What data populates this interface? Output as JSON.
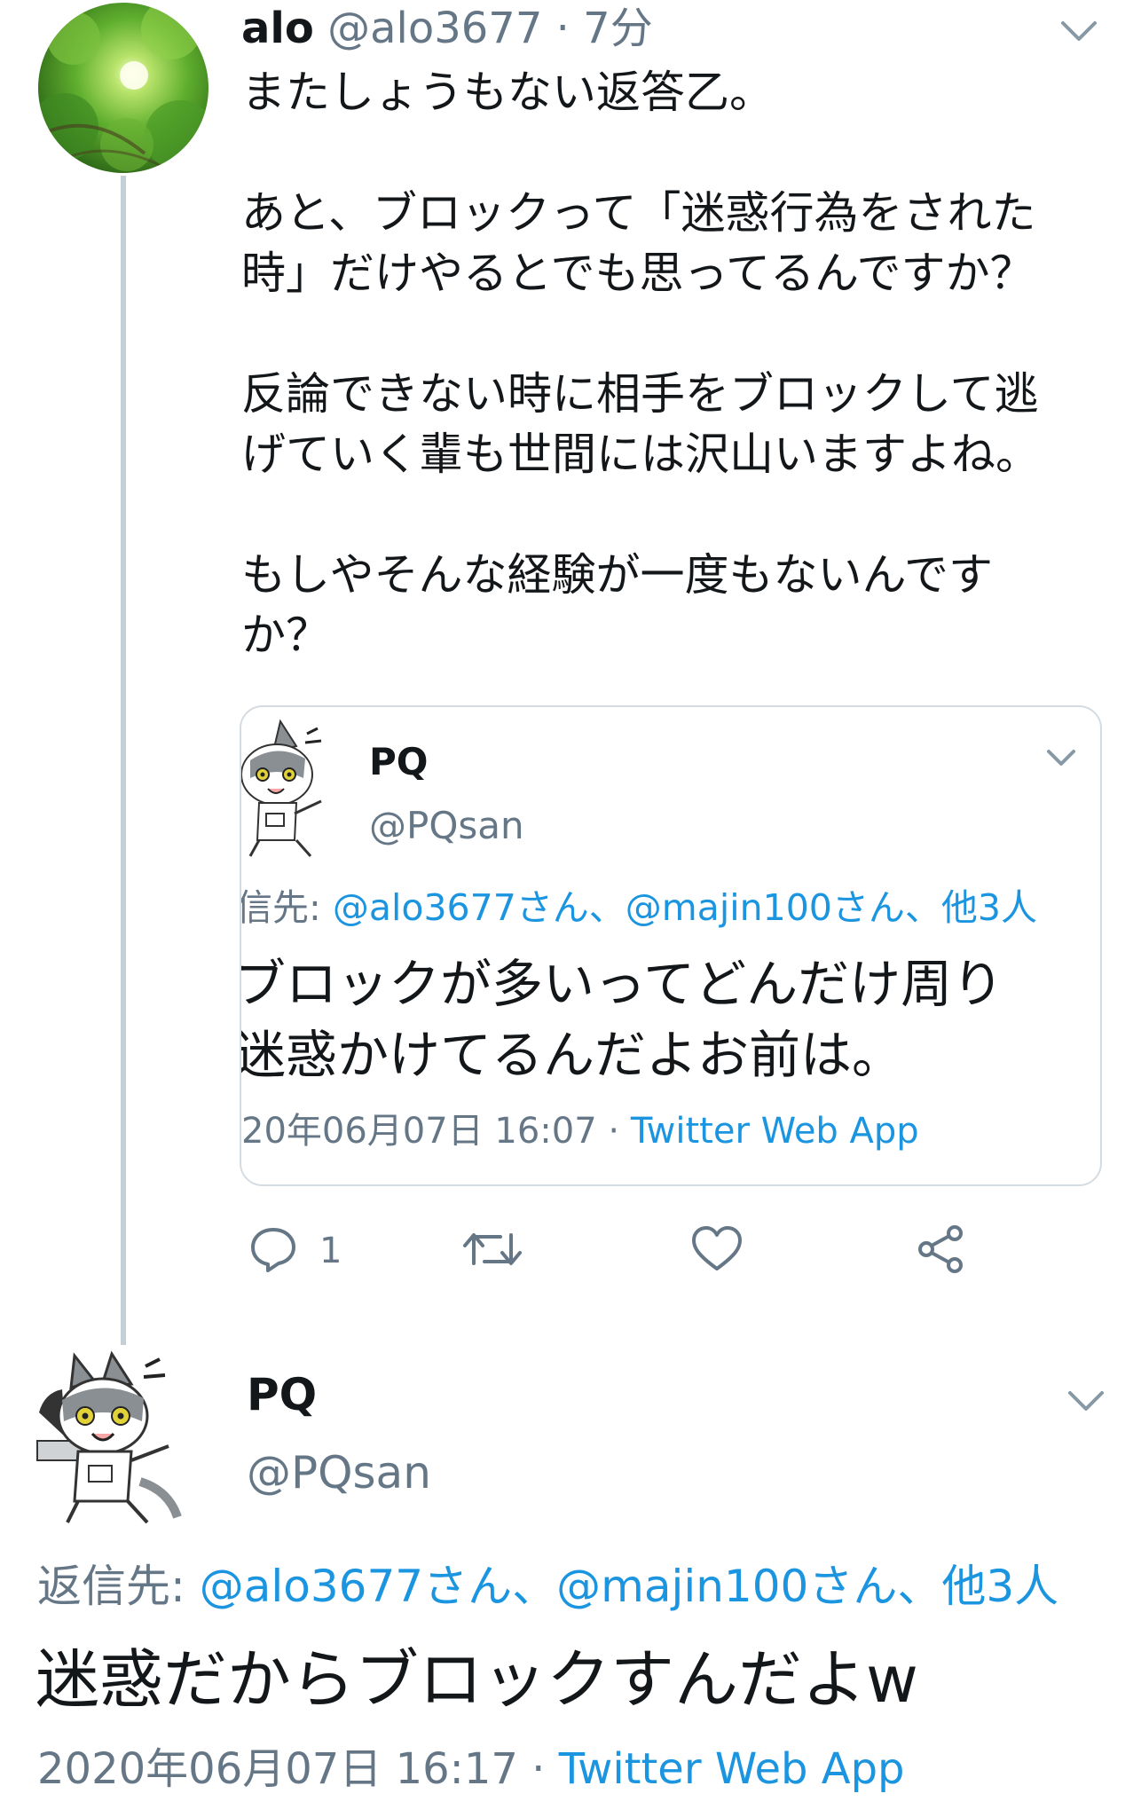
{
  "tweet1": {
    "name": "alo",
    "handle": "@alo3677",
    "time": "· 7分",
    "body": [
      "またしょうもない返答乙。",
      "あと、ブロックって「迷惑行為をされた",
      "時」だけやるとでも思ってるんですか？",
      "反論できない時に相手をブロックして逃",
      "げていく輩も世間には沢山いますよね。",
      "もしやそんな経験が一度もないんです",
      "か？"
    ],
    "reply_count": "1"
  },
  "quote": {
    "name": "PQ",
    "handle": "@PQsan",
    "reply_label": "信先: ",
    "reply_to": "@alo3677さん、@majin100さん、他3人",
    "text_lines": [
      "ブロックが多いってどんだけ周り",
      "迷惑かけてるんだよお前は。"
    ],
    "date": "20年06月07日 16:07 · ",
    "source": "Twitter Web App"
  },
  "tweet2": {
    "name": "PQ",
    "handle": "@PQsan",
    "reply_label": "返信先: ",
    "reply_to": "@alo3677さん、@majin100さん、他3人",
    "text": "迷惑だからブロックすんだよw",
    "date": "2020年06月07日 16:17 · ",
    "source": "Twitter Web App"
  },
  "colors": {
    "text": "#14171a",
    "secondary": "#657786",
    "link": "#1b95e0",
    "thread_line": "#c4cfd6",
    "card_border": "#d4dce2"
  },
  "icons": [
    "chevron-down-icon",
    "reply-icon",
    "retweet-icon",
    "like-icon",
    "share-icon"
  ]
}
